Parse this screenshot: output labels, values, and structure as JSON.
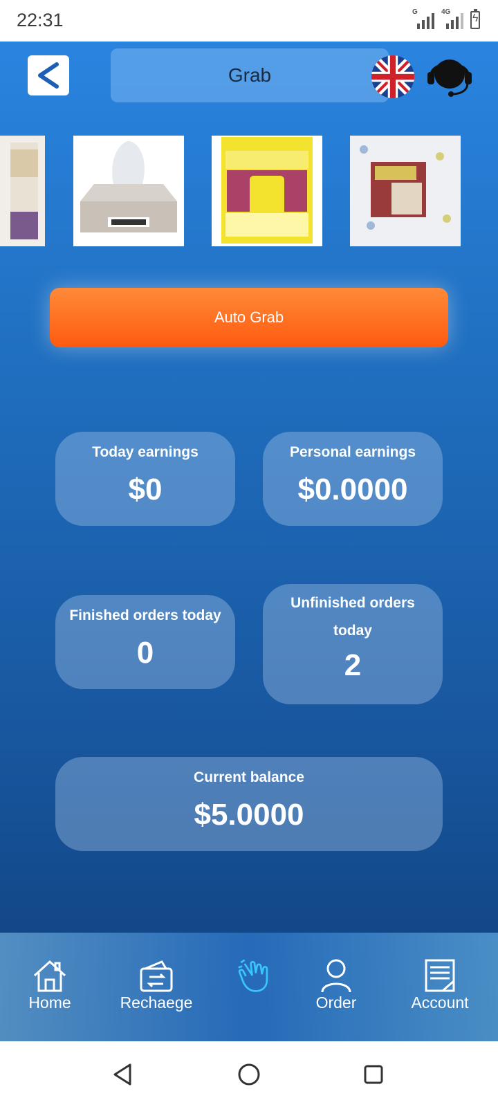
{
  "status_bar": {
    "time": "22:31",
    "network1": "G",
    "network2": "4G"
  },
  "header": {
    "title": "Grab",
    "back_icon": "chevron-left-icon",
    "language_icon": "uk-flag-icon",
    "support_icon": "headset-icon"
  },
  "products": [
    {
      "name": "product-balm"
    },
    {
      "name": "product-honest-wipes"
    },
    {
      "name": "product-keratin"
    },
    {
      "name": "product-huggies"
    }
  ],
  "actions": {
    "auto_grab_label": "Auto Grab"
  },
  "stats": {
    "today_earnings_label": "Today earnings",
    "today_earnings_value": "$0",
    "personal_earnings_label": "Personal earnings",
    "personal_earnings_value": "$0.0000",
    "finished_orders_label": "Finished orders today",
    "finished_orders_value": "0",
    "unfinished_orders_label_line1": "Unfinished orders",
    "unfinished_orders_label_line2": "today",
    "unfinished_orders_value": "2",
    "current_balance_label": "Current balance",
    "current_balance_value": "$5.0000"
  },
  "tabbar": {
    "home": "Home",
    "recharge": "Rechaege",
    "order": "Order",
    "account": "Account"
  },
  "colors": {
    "accent_orange": "#ff5a0e",
    "background_top": "#2a84df",
    "background_bottom": "#0f3f7b"
  }
}
